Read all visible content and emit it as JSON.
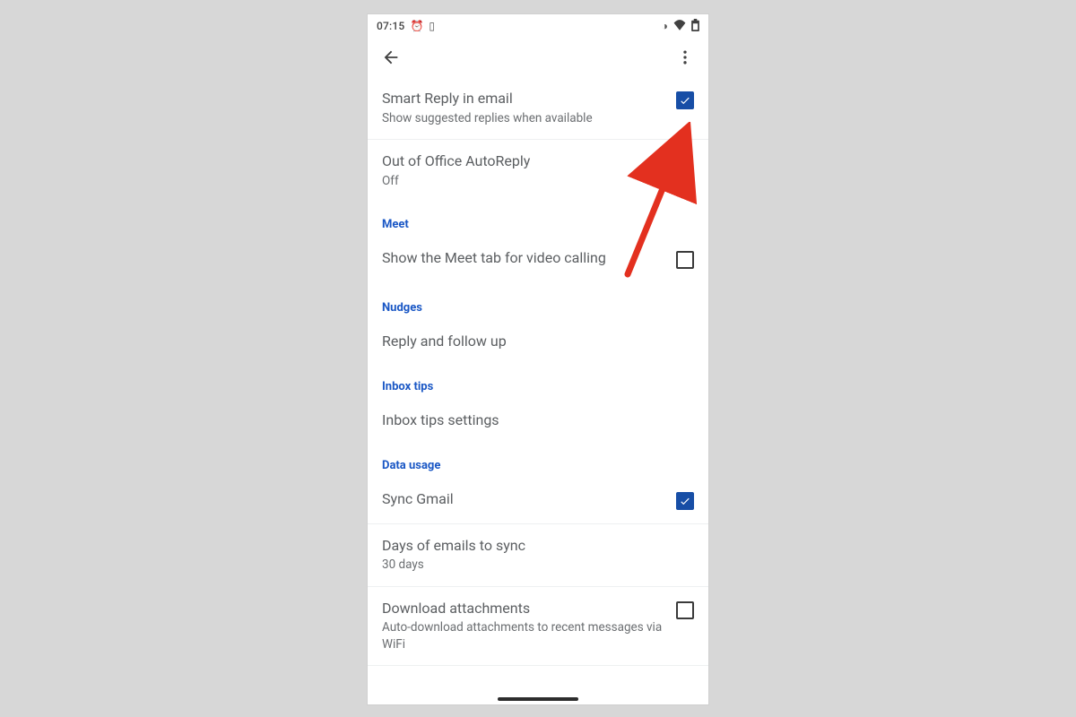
{
  "statusbar": {
    "time": "07:15"
  },
  "sections": {
    "meet": "Meet",
    "nudges": "Nudges",
    "inbox_tips": "Inbox tips",
    "data_usage": "Data usage"
  },
  "items": {
    "smart_reply": {
      "title": "Smart Reply in email",
      "sub": "Show suggested replies when available",
      "checked": true
    },
    "ooo": {
      "title": "Out of Office AutoReply",
      "sub": "Off"
    },
    "meet_tab": {
      "title": "Show the Meet tab for video calling",
      "checked": false
    },
    "nudges_item": {
      "title": "Reply and follow up"
    },
    "inbox_tips_item": {
      "title": "Inbox tips settings"
    },
    "sync_gmail": {
      "title": "Sync Gmail",
      "checked": true
    },
    "days_sync": {
      "title": "Days of emails to sync",
      "sub": "30 days"
    },
    "download_attach": {
      "title": "Download attachments",
      "sub": "Auto-download attachments to recent messages via WiFi",
      "checked": false
    }
  }
}
